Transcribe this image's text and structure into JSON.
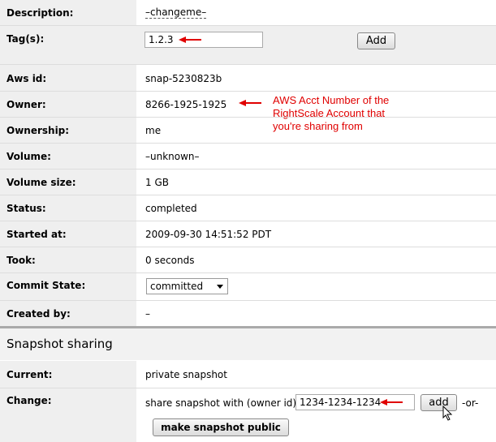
{
  "details": {
    "description": {
      "label": "Description:",
      "value": "–changeme–"
    },
    "tags": {
      "label": "Tag(s):",
      "input_value": "1.2.3",
      "add_label": "Add"
    },
    "aws_id": {
      "label": "Aws id:",
      "value": "snap-5230823b"
    },
    "owner": {
      "label": "Owner:",
      "value": "8266-1925-1925"
    },
    "ownership": {
      "label": "Ownership:",
      "value": "me"
    },
    "volume": {
      "label": "Volume:",
      "value": "–unknown–"
    },
    "volume_size": {
      "label": "Volume size:",
      "value": "1 GB"
    },
    "status": {
      "label": "Status:",
      "value": "completed"
    },
    "started_at": {
      "label": "Started at:",
      "value": "2009-09-30 14:51:52 PDT"
    },
    "took": {
      "label": "Took:",
      "value": "0 seconds"
    },
    "commit_state": {
      "label": "Commit State:",
      "selected": "committed"
    },
    "created_by": {
      "label": "Created by:",
      "value": "–"
    }
  },
  "sharing": {
    "heading": "Snapshot sharing",
    "current": {
      "label": "Current:",
      "value": "private snapshot"
    },
    "change": {
      "label": "Change:",
      "prompt": "share snapshot with (owner id):",
      "input_value": "1234-1234-1234",
      "add_label": "add",
      "or_text": "-or-",
      "public_label": "make snapshot public"
    }
  },
  "annotation": {
    "line1": "AWS Acct Number of the",
    "line2": "RightScale Account that",
    "line3": "you're sharing from"
  },
  "colors": {
    "annotation": "#e00000",
    "label_bg": "#efefef"
  }
}
